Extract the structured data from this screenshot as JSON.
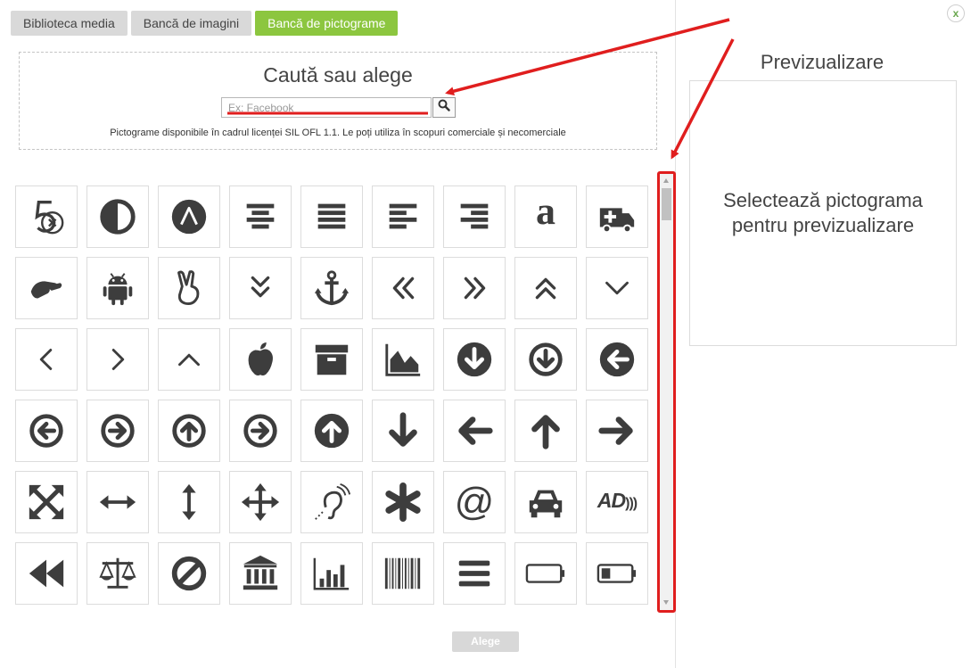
{
  "tabs": [
    {
      "label": "Biblioteca media",
      "active": false
    },
    {
      "label": "Bancă de imagini",
      "active": false
    },
    {
      "label": "Bancă de pictograme",
      "active": true
    }
  ],
  "close_label": "x",
  "search": {
    "title": "Caută sau alege",
    "placeholder": "Ex: Facebook",
    "license": "Pictograme disponibile în cadrul licenței SIL OFL 1.1. Le poți utiliza în scopuri comerciale și necomerciale"
  },
  "icons": [
    "500px-icon",
    "adjust-icon",
    "adn-icon",
    "align-center-icon",
    "align-justify-icon",
    "align-left-icon",
    "align-right-icon",
    "amazon-icon",
    "ambulance-icon",
    "sign-language-icon",
    "android-icon",
    "victory-hand-icon",
    "angle-double-down-icon",
    "anchor-icon",
    "angle-double-left-icon",
    "angle-double-right-icon",
    "angle-double-up-icon",
    "angle-down-icon",
    "angle-left-icon",
    "angle-right-icon",
    "angle-up-icon",
    "apple-icon",
    "archive-icon",
    "area-chart-icon",
    "arrow-circle-down-icon",
    "arrow-circle-o-down-icon",
    "arrow-circle-left-icon",
    "arrow-circle-o-left-icon",
    "arrow-circle-o-right-icon",
    "arrow-circle-o-up-icon",
    "arrow-circle-right-icon",
    "arrow-circle-up-icon",
    "arrow-down-icon",
    "arrow-left-icon",
    "arrow-up-icon",
    "arrow-right-icon",
    "arrows-alt-icon",
    "arrows-h-icon",
    "arrows-v-icon",
    "arrows-icon",
    "assistive-listening-icon",
    "asterisk-icon",
    "at-icon",
    "automobile-icon",
    "audio-description-icon",
    "backward-icon",
    "balance-scale-icon",
    "ban-icon",
    "bank-icon",
    "bar-chart-icon",
    "barcode-icon",
    "bars-icon",
    "battery-empty-icon",
    "battery-quarter-icon"
  ],
  "preview": {
    "title": "Previzualizare",
    "placeholder": "Selectează pictograma pentru previzualizare"
  },
  "choose_label": "Alege",
  "colors": {
    "active_tab": "#8cc63f",
    "annotation": "#e01e1e",
    "icon": "#3d3d3d"
  }
}
